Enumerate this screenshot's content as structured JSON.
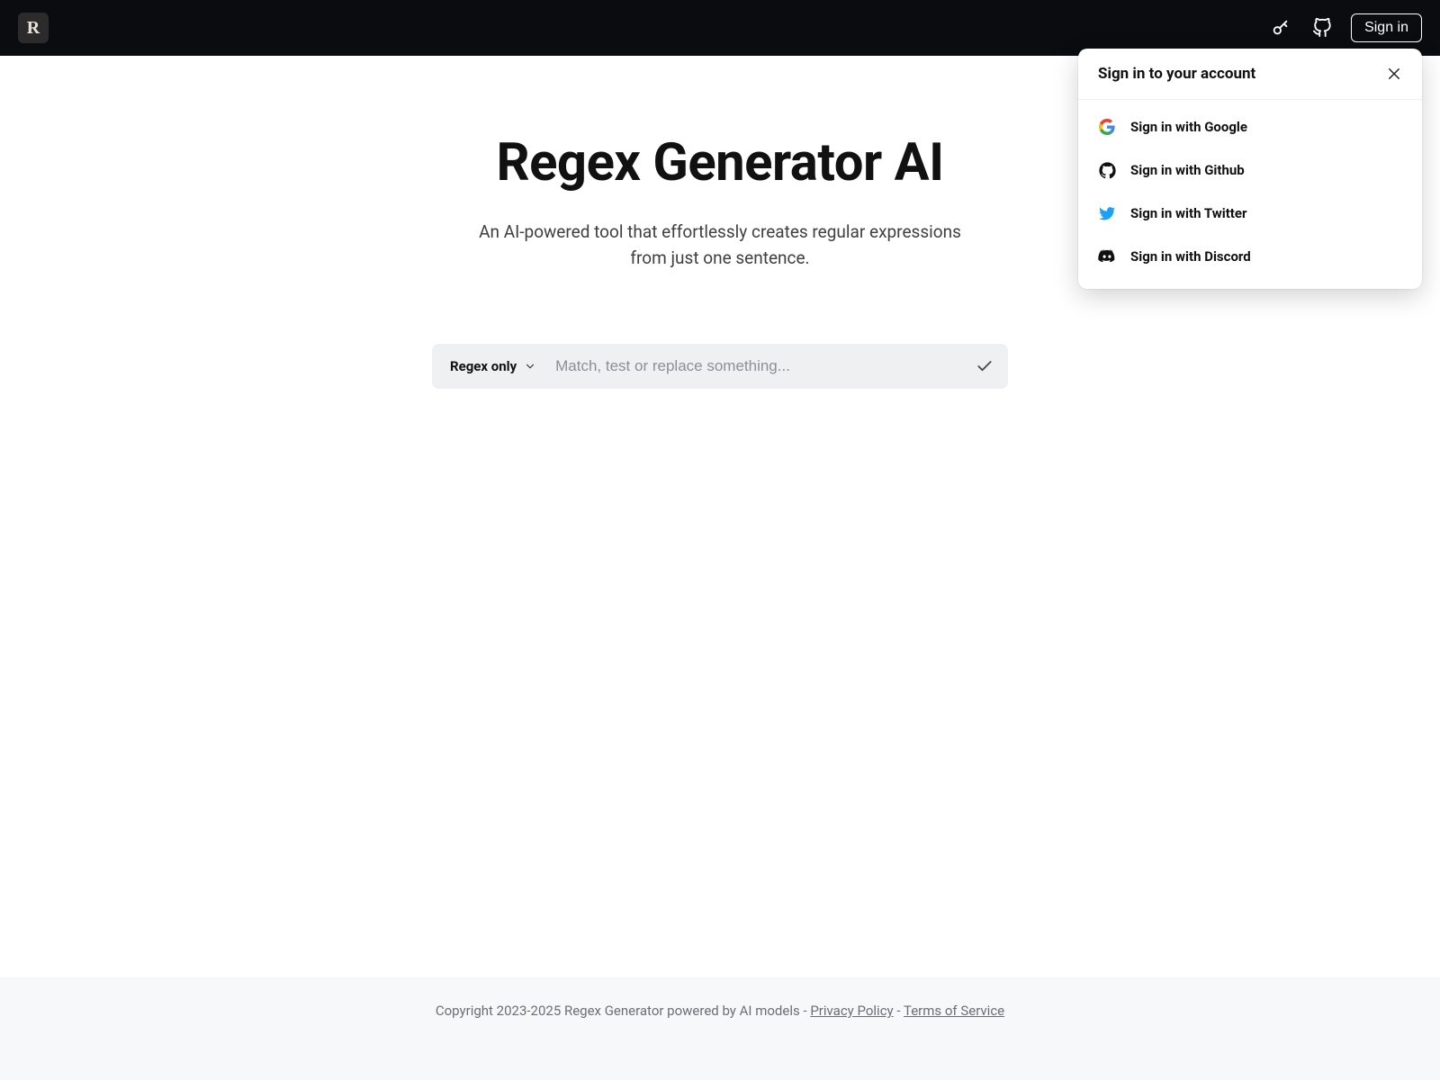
{
  "header": {
    "logo_letter": "R",
    "signin_label": "Sign in"
  },
  "hero": {
    "title": "Regex Generator AI",
    "subtitle": "An AI-powered tool that effortlessly creates regular expressions from just one sentence."
  },
  "input": {
    "mode_label": "Regex only",
    "placeholder": "Match, test or replace something..."
  },
  "signin_panel": {
    "title": "Sign in to your account",
    "options": [
      {
        "label": "Sign in with Google",
        "provider": "google"
      },
      {
        "label": "Sign in with Github",
        "provider": "github"
      },
      {
        "label": "Sign in with Twitter",
        "provider": "twitter"
      },
      {
        "label": "Sign in with Discord",
        "provider": "discord"
      }
    ]
  },
  "footer": {
    "copyright": "Copyright 2023-2025 Regex Generator powered by AI models - ",
    "privacy": "Privacy Policy",
    "sep": " - ",
    "terms": "Terms of Service"
  }
}
